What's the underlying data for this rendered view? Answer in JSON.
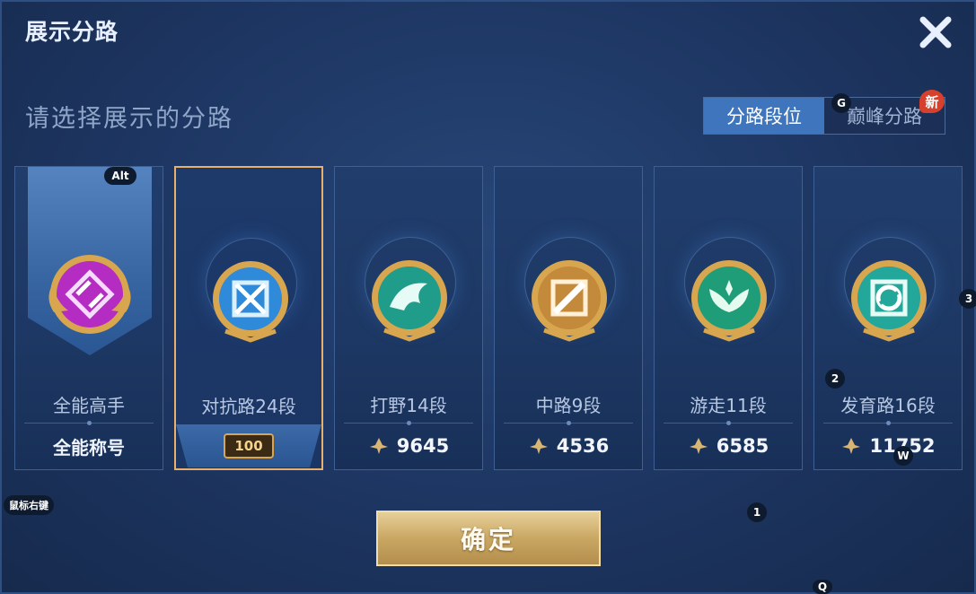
{
  "title": "展示分路",
  "subtitle": "请选择展示的分路",
  "tabs": [
    {
      "label": "分路段位",
      "active": true
    },
    {
      "label": "巅峰分路",
      "active": false
    }
  ],
  "new_badge": "新",
  "key_hints": {
    "tab_key": "G",
    "alt_key": "Alt",
    "right_click": "鼠标右键",
    "confirm_key": "1",
    "card_key_2": "2",
    "card_key_3": "3",
    "w_key": "W",
    "q_key": "Q"
  },
  "cards": [
    {
      "name": "全能高手",
      "label": "全能称号",
      "color": "#b52cc2",
      "icon": "all-round-emblem-icon"
    },
    {
      "name": "对抗路24段",
      "level": "100",
      "color": "#2f8ad9",
      "icon": "clash-lane-emblem-icon",
      "selected": true
    },
    {
      "name": "打野14段",
      "score": "9645",
      "color": "#1f9c8a",
      "icon": "jungle-emblem-icon"
    },
    {
      "name": "中路9段",
      "score": "4536",
      "color": "#c48a3b",
      "icon": "mid-lane-emblem-icon"
    },
    {
      "name": "游走11段",
      "score": "6585",
      "color": "#1f9c78",
      "icon": "roam-emblem-icon"
    },
    {
      "name": "发育路16段",
      "score": "11752",
      "color": "#23a79a",
      "icon": "farm-lane-emblem-icon"
    }
  ],
  "confirm_label": "确定",
  "colors": {
    "accent_gold": "#c9a763",
    "tab_active": "#3f75bd",
    "selected_border": "#e8b06a"
  }
}
